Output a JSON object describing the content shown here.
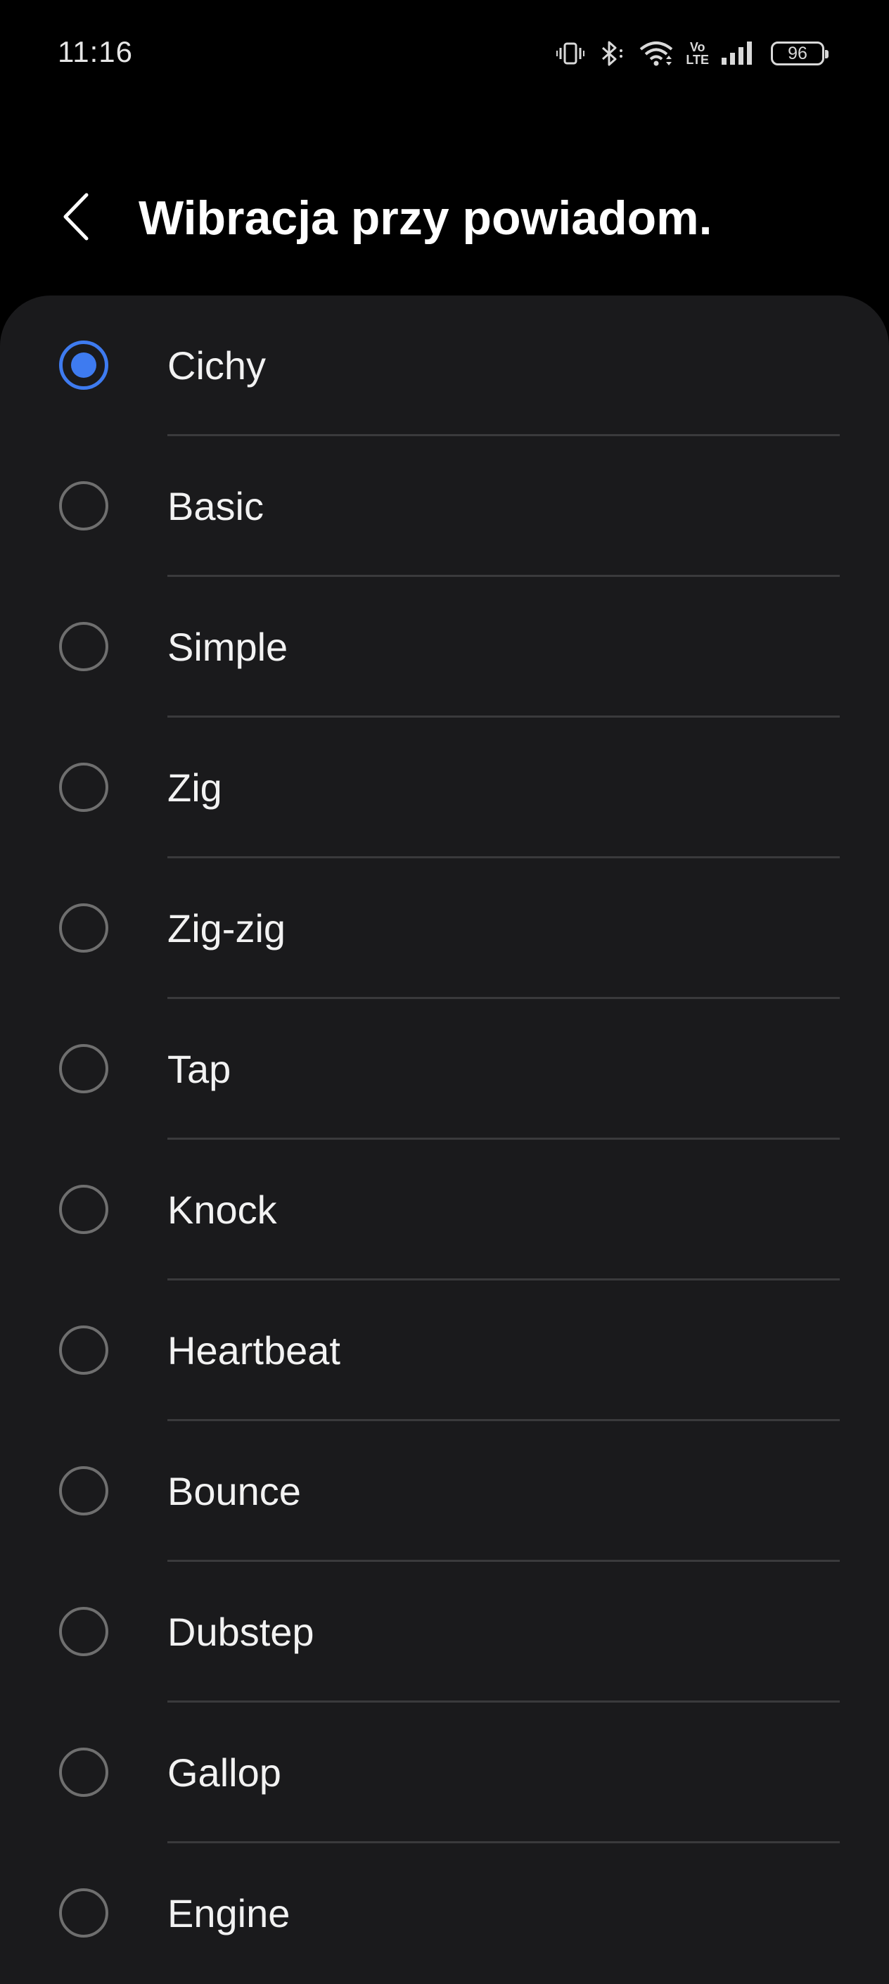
{
  "status_bar": {
    "time": "11:16",
    "battery_level": "96",
    "icons": [
      "vibrate-icon",
      "bluetooth-icon",
      "wifi-icon",
      "volte-icon",
      "signal-icon",
      "battery-icon"
    ],
    "volte_text_top": "Vo",
    "volte_text_bottom": "LTE"
  },
  "header": {
    "title": "Wibracja przy powiadom.",
    "back_icon": "chevron-left-icon"
  },
  "colors": {
    "background": "#000000",
    "card": "#1a1a1c",
    "accent": "#3e7bf0",
    "divider": "#3a3a3c",
    "radio_unchecked": "#6f6f6f"
  },
  "options": [
    {
      "label": "Cichy",
      "selected": true
    },
    {
      "label": "Basic",
      "selected": false
    },
    {
      "label": "Simple",
      "selected": false
    },
    {
      "label": "Zig",
      "selected": false
    },
    {
      "label": "Zig-zig",
      "selected": false
    },
    {
      "label": "Tap",
      "selected": false
    },
    {
      "label": "Knock",
      "selected": false
    },
    {
      "label": "Heartbeat",
      "selected": false
    },
    {
      "label": "Bounce",
      "selected": false
    },
    {
      "label": "Dubstep",
      "selected": false
    },
    {
      "label": "Gallop",
      "selected": false
    },
    {
      "label": "Engine",
      "selected": false
    }
  ]
}
